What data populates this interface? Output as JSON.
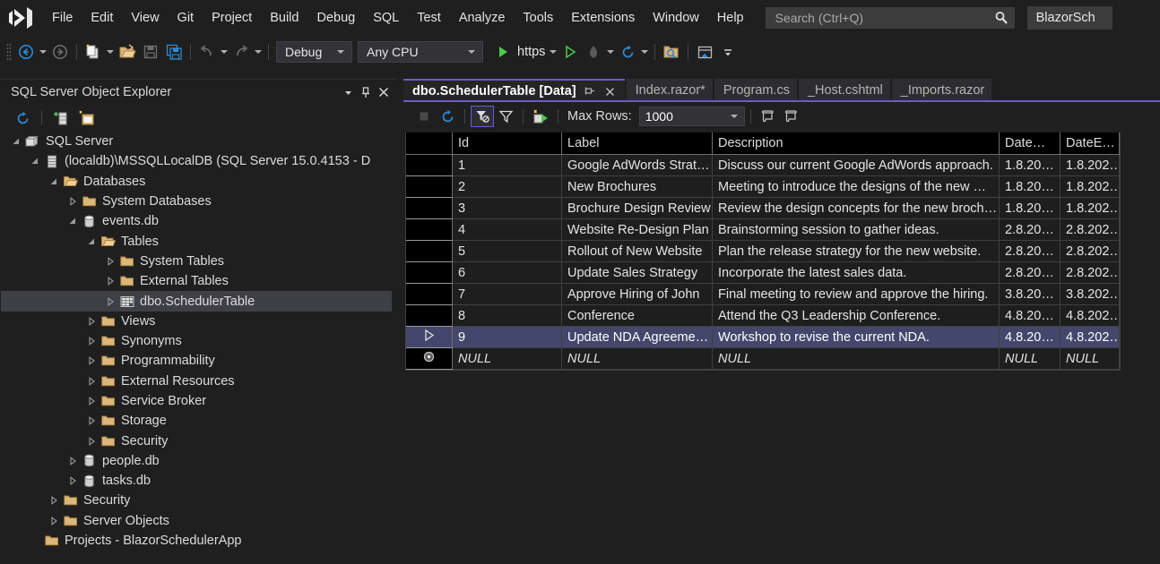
{
  "menubar": {
    "logo": "visual-studio-logo",
    "items": [
      "File",
      "Edit",
      "View",
      "Git",
      "Project",
      "Build",
      "Debug",
      "SQL",
      "Test",
      "Analyze",
      "Tools",
      "Extensions",
      "Window",
      "Help"
    ],
    "search_placeholder": "Search (Ctrl+Q)",
    "search_icon": "search-icon",
    "solution_name": "BlazorSch"
  },
  "toolbar": {
    "nav_back_icon": "navigate-back-icon",
    "nav_forward_icon": "navigate-forward-icon",
    "new_item_icon": "new-item-icon",
    "open_file_icon": "open-file-icon",
    "save_icon": "save-icon",
    "save_all_icon": "save-all-icon",
    "undo_icon": "undo-icon",
    "redo_icon": "redo-icon",
    "config_label": "Debug",
    "platform_label": "Any CPU",
    "run_icon": "run-play-icon",
    "run_label": "https",
    "run_nodebug_icon": "start-without-debugging-icon",
    "hot_reload_icon": "hot-reload-icon",
    "restart_icon": "restart-icon",
    "folder_search_icon": "folder-search-icon",
    "window_layout_icon": "window-layout-icon",
    "overflow_icon": "toolbar-overflow-icon"
  },
  "explorer": {
    "title": "SQL Server Object Explorer",
    "dropdown_icon": "chevron-down-icon",
    "pin_icon": "pin-icon",
    "close_icon": "close-icon",
    "refresh_icon": "refresh-icon",
    "add_server_icon": "add-sql-server-icon",
    "new_query_icon": "new-query-icon",
    "tree": [
      {
        "label": "SQL Server",
        "depth": 0,
        "state": "expanded",
        "icon": "sql-server-icon"
      },
      {
        "label": "(localdb)\\MSSQLLocalDB (SQL Server 15.0.4153 - D",
        "depth": 1,
        "state": "expanded",
        "icon": "server-instance-icon"
      },
      {
        "label": "Databases",
        "depth": 2,
        "state": "expanded",
        "icon": "folder-open-icon"
      },
      {
        "label": "System Databases",
        "depth": 3,
        "state": "collapsed",
        "icon": "folder-icon"
      },
      {
        "label": "events.db",
        "depth": 3,
        "state": "expanded",
        "icon": "database-icon"
      },
      {
        "label": "Tables",
        "depth": 4,
        "state": "expanded",
        "icon": "folder-open-icon"
      },
      {
        "label": "System Tables",
        "depth": 5,
        "state": "collapsed",
        "icon": "folder-icon"
      },
      {
        "label": "External Tables",
        "depth": 5,
        "state": "collapsed",
        "icon": "folder-icon"
      },
      {
        "label": "dbo.SchedulerTable",
        "depth": 5,
        "state": "collapsed",
        "icon": "table-icon",
        "selected": true
      },
      {
        "label": "Views",
        "depth": 4,
        "state": "collapsed",
        "icon": "folder-icon"
      },
      {
        "label": "Synonyms",
        "depth": 4,
        "state": "collapsed",
        "icon": "folder-icon"
      },
      {
        "label": "Programmability",
        "depth": 4,
        "state": "collapsed",
        "icon": "folder-icon"
      },
      {
        "label": "External Resources",
        "depth": 4,
        "state": "collapsed",
        "icon": "folder-icon"
      },
      {
        "label": "Service Broker",
        "depth": 4,
        "state": "collapsed",
        "icon": "folder-icon"
      },
      {
        "label": "Storage",
        "depth": 4,
        "state": "collapsed",
        "icon": "folder-icon"
      },
      {
        "label": "Security",
        "depth": 4,
        "state": "collapsed",
        "icon": "folder-icon"
      },
      {
        "label": "people.db",
        "depth": 3,
        "state": "collapsed",
        "icon": "database-icon"
      },
      {
        "label": "tasks.db",
        "depth": 3,
        "state": "collapsed",
        "icon": "database-icon"
      },
      {
        "label": "Security",
        "depth": 2,
        "state": "collapsed",
        "icon": "folder-icon"
      },
      {
        "label": "Server Objects",
        "depth": 2,
        "state": "collapsed",
        "icon": "folder-icon"
      },
      {
        "label": "Projects - BlazorSchedulerApp",
        "depth": 1,
        "state": "leaf",
        "icon": "folder-icon"
      }
    ]
  },
  "tabs": [
    {
      "label": "dbo.SchedulerTable [Data]",
      "active": true,
      "pin_icon": "pin-icon",
      "close_icon": "close-icon"
    },
    {
      "label": "Index.razor*",
      "active": false
    },
    {
      "label": "Program.cs",
      "active": false
    },
    {
      "label": "_Host.cshtml",
      "active": false
    },
    {
      "label": "_Imports.razor",
      "active": false
    }
  ],
  "grid_toolbar": {
    "stop_icon": "stop-icon",
    "refresh_icon": "refresh-icon",
    "filter_settings_icon": "filter-settings-icon",
    "sort_filter_icon": "sort-filter-icon",
    "script_icon": "script-execute-icon",
    "max_rows_label": "Max Rows:",
    "max_rows_value": "1000",
    "max_rows_caret": "chevron-down-icon",
    "script_as_create_icon": "script-as-create-icon",
    "script_as_update_icon": "script-as-update-icon"
  },
  "data_grid": {
    "columns": [
      "Id",
      "Label",
      "Description",
      "Date…",
      "DateE…"
    ],
    "rows": [
      {
        "marker": "",
        "id": "1",
        "label": "Google AdWords Strat…",
        "description": "Discuss our current Google AdWords approach.",
        "date_start": "1.8.20…",
        "date_end": "1.8.202…"
      },
      {
        "marker": "",
        "id": "2",
        "label": "New Brochures",
        "description": "Meeting to introduce the designs of the new …",
        "date_start": "1.8.20…",
        "date_end": "1.8.202…"
      },
      {
        "marker": "",
        "id": "3",
        "label": "Brochure Design Review",
        "description": "Review the design concepts for the new broch…",
        "date_start": "1.8.20…",
        "date_end": "1.8.202…"
      },
      {
        "marker": "",
        "id": "4",
        "label": "Website Re-Design Plan",
        "description": "Brainstorming session to gather ideas.",
        "date_start": "2.8.20…",
        "date_end": "2.8.202…"
      },
      {
        "marker": "",
        "id": "5",
        "label": "Rollout of New Website",
        "description": "Plan the release strategy for the new website.",
        "date_start": "2.8.20…",
        "date_end": "2.8.202…"
      },
      {
        "marker": "",
        "id": "6",
        "label": "Update Sales Strategy",
        "description": "Incorporate the latest sales data.",
        "date_start": "2.8.20…",
        "date_end": "2.8.202…"
      },
      {
        "marker": "",
        "id": "7",
        "label": "Approve Hiring of John",
        "description": "Final meeting to review and approve the hiring.",
        "date_start": "3.8.20…",
        "date_end": "3.8.202…"
      },
      {
        "marker": "",
        "id": "8",
        "label": "Conference",
        "description": "Attend the Q3 Leadership Conference.",
        "date_start": "4.8.20…",
        "date_end": "4.8.202…"
      },
      {
        "marker": "current-row-arrow",
        "id": "9",
        "label": "Update NDA Agreeme…",
        "description": "Workshop to revise the current NDA.",
        "date_start": "4.8.20…",
        "date_end": "4.8.202…",
        "selected": true
      },
      {
        "marker": "new-row-icon",
        "id": "NULL",
        "label": "NULL",
        "description": "NULL",
        "date_start": "NULL",
        "date_end": "NULL",
        "is_null": true
      }
    ]
  },
  "colors": {
    "accent_purple": "#6a5acd",
    "selection": "#44476b",
    "chrome_bg": "#1f1f1f",
    "grid_bg": "#1e1e1e",
    "blue_icon": "#2e8ad8",
    "green_run": "#4ec94e",
    "folder_gold": "#dcb67a"
  }
}
